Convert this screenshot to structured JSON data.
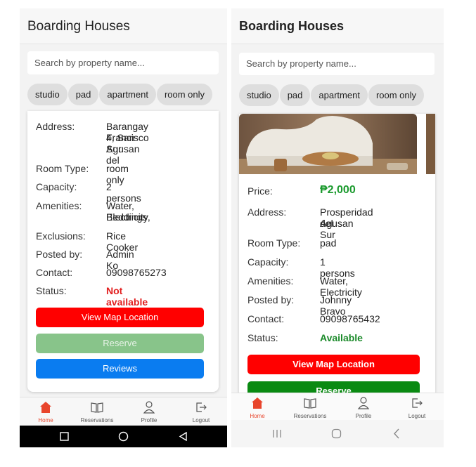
{
  "left": {
    "title": "Boarding Houses",
    "search_placeholder": "Search by property name...",
    "chips": [
      "studio",
      "pad",
      "apartment",
      "room only"
    ],
    "labels": {
      "address": "Address:",
      "room_type": "Room Type:",
      "capacity": "Capacity:",
      "amenities": "Amenities:",
      "exclusions": "Exclusions:",
      "posted_by": "Posted by:",
      "contact": "Contact:",
      "status": "Status:"
    },
    "values": {
      "address_line1": "Barangay 4, San",
      "address_line2": "Francisco Agusan del",
      "address_line3": "Sur",
      "room_type": "room only",
      "capacity": "2 persons",
      "amenities_line1": "Water, Electricity,",
      "amenities_line2": "Beddings",
      "exclusions": "Rice Cooker",
      "posted_by": "Admin Ko",
      "contact": "09098765273",
      "status": "Not available"
    },
    "buttons": {
      "map": "View Map Location",
      "reserve": "Reserve",
      "reviews": "Reviews"
    }
  },
  "right": {
    "title": "Boarding Houses",
    "search_placeholder": "Search by property name...",
    "chips": [
      "studio",
      "pad",
      "apartment",
      "room only"
    ],
    "labels": {
      "price": "Price:",
      "address": "Address:",
      "room_type": "Room Type:",
      "capacity": "Capacity:",
      "amenities": "Amenities:",
      "posted_by": "Posted by:",
      "contact": "Contact:",
      "status": "Status:"
    },
    "values": {
      "price": "₱2,000",
      "address_line1": "Prosperidad Agusan",
      "address_line2": "del Sur",
      "room_type": "pad",
      "capacity": "1 persons",
      "amenities": "Water, Electricity",
      "posted_by": "Johnny Bravo",
      "contact": "09098765432",
      "status": "Available"
    },
    "buttons": {
      "map": "View Map Location",
      "reserve": "Reserve"
    }
  },
  "nav": {
    "home": "Home",
    "reservations": "Reservations",
    "profile": "Profile",
    "logout": "Logout"
  },
  "colors": {
    "primary_red": "#ff0000",
    "available_green": "#1b8a2a",
    "unavailable_red": "#e21e1e",
    "reviews_blue": "#0a7cf0",
    "active_nav": "#e8452c"
  }
}
